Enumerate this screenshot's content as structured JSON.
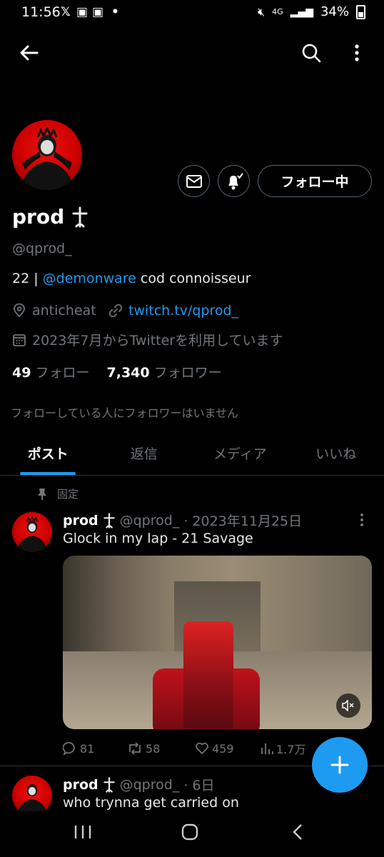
{
  "status_bar": {
    "time": "11:56",
    "notif_icons": [
      "X",
      "twitch",
      "twitch",
      "•"
    ],
    "battery": "34%",
    "network": "4G"
  },
  "profile": {
    "name": "prod",
    "handle": "@qprod_",
    "bio_prefix": "22 | ",
    "bio_mention": "@demonware",
    "bio_suffix": " cod connoisseur",
    "location": "anticheat",
    "website": "twitch.tv/qprod_",
    "joined": "2023年7月からTwitterを利用しています",
    "following_count": "49",
    "following_label": "フォロー",
    "followers_count": "7,340",
    "followers_label": "フォロワー",
    "known_followers": "フォローしている人にフォロワーはいません",
    "follow_button": "フォロー中"
  },
  "tabs": [
    {
      "label": "ポスト"
    },
    {
      "label": "返信"
    },
    {
      "label": "メディア"
    },
    {
      "label": "いいね"
    }
  ],
  "pinned_label": "固定",
  "posts": [
    {
      "name": "prod",
      "handle": "@qprod_",
      "date": "· 2023年11月25日",
      "text": "Glock in my lap - 21 Savage",
      "replies": "81",
      "reposts": "58",
      "likes": "459",
      "views": "1.7万"
    },
    {
      "name": "prod",
      "handle": "@qprod_",
      "date": "· 6日",
      "text": "who trynna get carried on"
    }
  ],
  "colors": {
    "accent": "#1d9bf0",
    "muted": "#71767b",
    "border": "#2f3336"
  }
}
